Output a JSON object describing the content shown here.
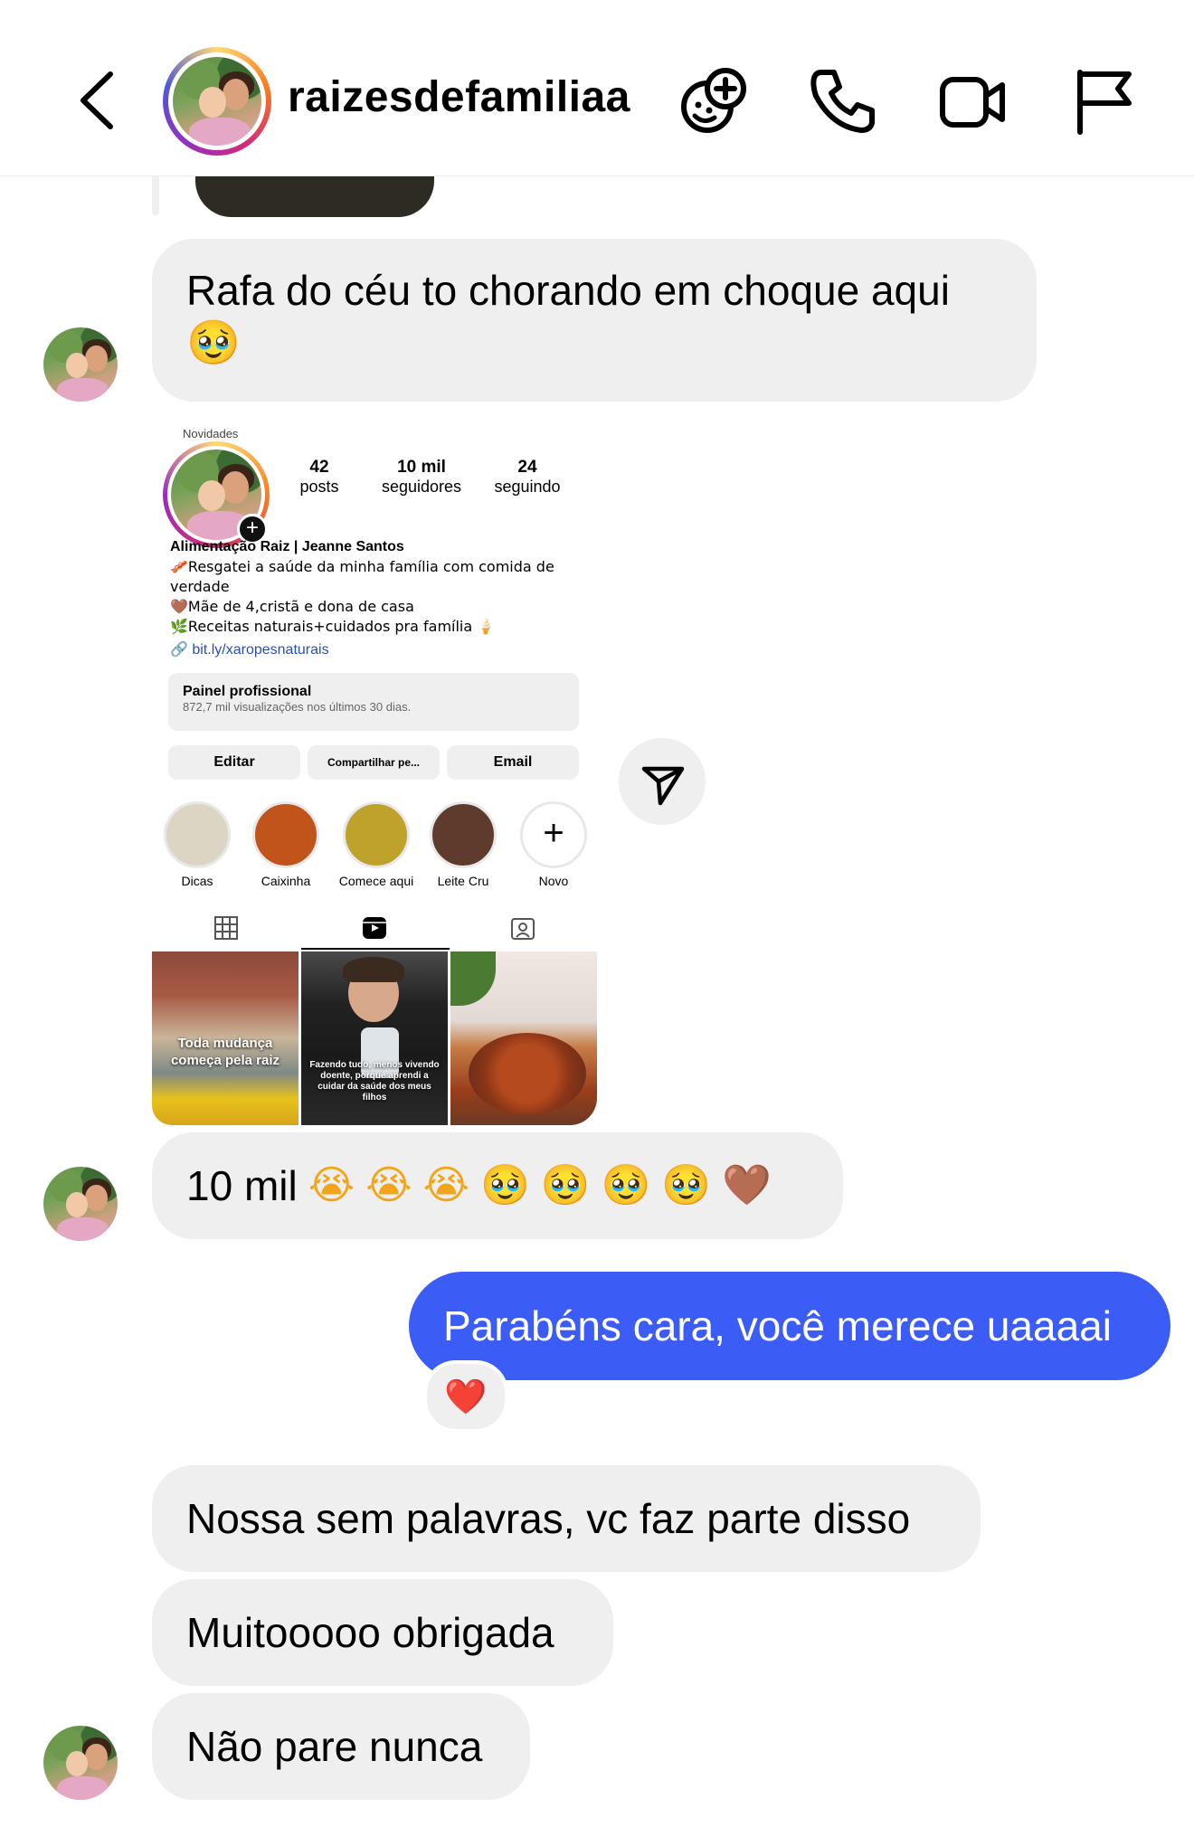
{
  "header": {
    "username": "raizesdefamiliaa"
  },
  "messages": {
    "rafa": "Rafa do céu to chorando em choque aqui",
    "rafa_emoji": "🥹",
    "ten_mil": "10 mil",
    "ten_mil_emojis": [
      "😭",
      "😭",
      "😭",
      "🥹",
      "🥹",
      "🥹",
      "🥹",
      "🤎"
    ],
    "mine": "Parabéns cara, você merece uaaaai",
    "reaction": "❤️",
    "nossa": "Nossa sem palavras, vc faz parte disso",
    "muito": "Muitooooo obrigada",
    "nao": "Não pare nunca"
  },
  "profile": {
    "novidades": "Novidades",
    "posts_count": "42",
    "posts_label": "posts",
    "followers_count": "10 mil",
    "followers_label": "seguidores",
    "following_count": "24",
    "following_label": "seguindo",
    "name": "Alimentação Raiz | Jeanne Santos",
    "bio1": "🥓Resgatei a saúde da minha família com comida de verdade",
    "bio2": "🤎Mãe de 4,cristã e dona de casa",
    "bio3": "🌿Receitas naturais+cuidados pra família 🍦",
    "link": "bit.ly/xaropesnaturais",
    "panel_title": "Painel profissional",
    "panel_sub": "872,7 mil visualizações nos últimos 30 dias.",
    "btn_edit": "Editar",
    "btn_share": "Compartilhar pe...",
    "btn_email": "Email",
    "highlights": [
      {
        "label": "Dicas",
        "color": "#ddd5c4"
      },
      {
        "label": "Caixinha",
        "color": "#c0541a"
      },
      {
        "label": "Comece aqui",
        "color": "#bfa22c"
      },
      {
        "label": "Leite Cru",
        "color": "#5e3b2d"
      },
      {
        "label": "Novo",
        "color": "#ffffff"
      }
    ],
    "post1_caption": "Toda mudança começa pela raiz",
    "post2_caption": "Fazendo tudo, menos vivendo doente, porque aprendi a cuidar da saúde dos meus filhos"
  },
  "colors": {
    "accent_blue": "#3b5cf5",
    "bubble_grey": "#efefef"
  }
}
